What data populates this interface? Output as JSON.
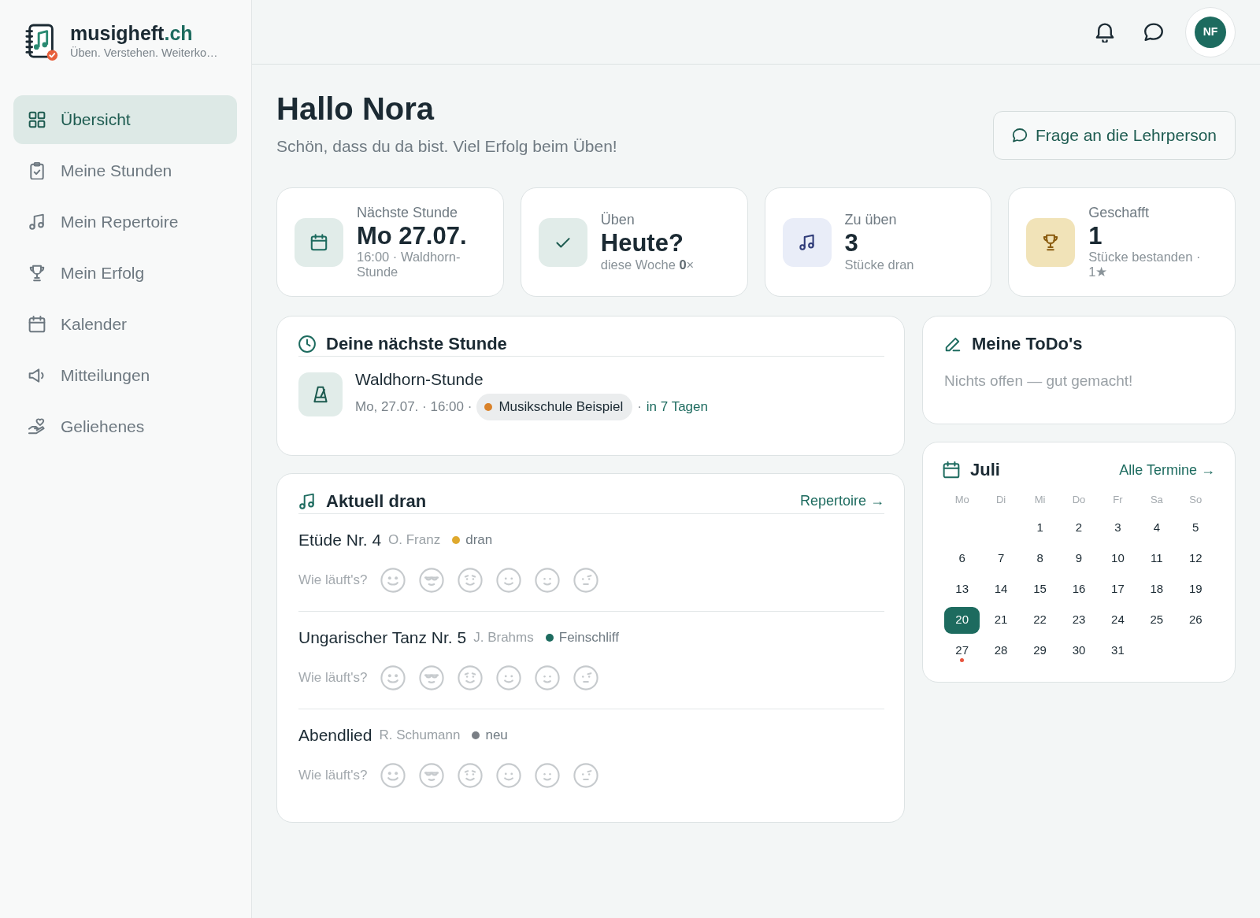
{
  "brand": {
    "name": "musigheft",
    "suffix": ".ch",
    "tagline": "Üben. Verstehen. Weiterko…"
  },
  "sidebar": {
    "items": [
      {
        "label": "Übersicht",
        "selected": true
      },
      {
        "label": "Meine Stunden",
        "selected": false
      },
      {
        "label": "Mein Repertoire",
        "selected": false
      },
      {
        "label": "Mein Erfolg",
        "selected": false
      },
      {
        "label": "Kalender",
        "selected": false
      },
      {
        "label": "Mitteilungen",
        "selected": false
      },
      {
        "label": "Geliehenes",
        "selected": false
      }
    ]
  },
  "header": {
    "avatar": {
      "initials": "NF"
    }
  },
  "greeting": {
    "title": "Hallo Nora",
    "subtitle": "Schön, dass du da bist. Viel Erfolg beim Üben!",
    "button": "Frage an die Lehrperson"
  },
  "stats": [
    {
      "label": "Nächste Stunde",
      "value": "Mo 27.07.",
      "note": "16:00 · Waldhorn-Stunde"
    },
    {
      "label": "Üben",
      "value": "Heute?",
      "note": "diese Woche **0**×"
    },
    {
      "label": "Zu üben",
      "value": "3",
      "note": "Stücke dran"
    },
    {
      "label": "Geschafft",
      "value": "1",
      "note": "Stücke bestanden · 1★"
    }
  ],
  "next_lesson": {
    "title": "Deine nächste Stunde",
    "name": "Waldhorn-Stunde",
    "time": "Mo, 27.07. · 16:00 ·",
    "place": {
      "label": "Musikschule Beispiel",
      "color": "#d9822b"
    },
    "separator": "·",
    "relative": "in 7 Tagen"
  },
  "todos": {
    "title": "Meine ToDo's",
    "empty_message": "Nichts offen — gut gemacht!"
  },
  "current": {
    "title": "Aktuell dran",
    "link": "Repertoire →",
    "items": [
      {
        "title": "Etüde Nr. 4",
        "composer": "O. Franz",
        "status": "dran",
        "color": "#dfa92e",
        "prompt": "Wie läuft's?",
        "moods": [
          {
            "selected": false
          },
          {
            "selected": false
          },
          {
            "selected": false
          },
          {
            "selected": false
          },
          {
            "selected": false
          },
          {
            "selected": false
          }
        ]
      },
      {
        "title": "Ungarischer Tanz Nr. 5",
        "composer": "J. Brahms",
        "status": "Feinschliff",
        "color": "#1d6b5f",
        "prompt": "Wie läuft's?",
        "moods": [
          {
            "selected": false
          },
          {
            "selected": false
          },
          {
            "selected": false
          },
          {
            "selected": false
          },
          {
            "selected": false
          },
          {
            "selected": false
          }
        ]
      },
      {
        "title": "Abendlied",
        "composer": "R. Schumann",
        "status": "neu",
        "color": "#7a7f85",
        "prompt": "Wie läuft's?",
        "moods": [
          {
            "selected": false
          },
          {
            "selected": false
          },
          {
            "selected": false
          },
          {
            "selected": false
          },
          {
            "selected": false
          },
          {
            "selected": false
          }
        ]
      }
    ]
  },
  "calendar": {
    "month": "Juli",
    "link": "Alle Termine →",
    "weekdays": [
      "Mo",
      "Di",
      "Mi",
      "Do",
      "Fr",
      "Sa",
      "So"
    ],
    "weeks": [
      [
        {
          "day": "1",
          "selected": false,
          "event": false
        },
        {
          "day": "2",
          "selected": false,
          "event": false
        },
        {
          "day": "3",
          "selected": false,
          "event": false
        },
        {
          "day": "4",
          "selected": false,
          "event": false
        },
        {
          "day": "5",
          "selected": false,
          "event": false
        }
      ],
      [
        {
          "day": "6",
          "selected": false,
          "event": false
        },
        {
          "day": "7",
          "selected": false,
          "event": false
        },
        {
          "day": "8",
          "selected": false,
          "event": false
        },
        {
          "day": "9",
          "selected": false,
          "event": false
        },
        {
          "day": "10",
          "selected": false,
          "event": false
        },
        {
          "day": "11",
          "selected": false,
          "event": false
        },
        {
          "day": "12",
          "selected": false,
          "event": false
        }
      ],
      [
        {
          "day": "13",
          "selected": false,
          "event": false
        },
        {
          "day": "14",
          "selected": false,
          "event": false
        },
        {
          "day": "15",
          "selected": false,
          "event": false
        },
        {
          "day": "16",
          "selected": false,
          "event": false
        },
        {
          "day": "17",
          "selected": false,
          "event": false
        },
        {
          "day": "18",
          "selected": false,
          "event": false
        },
        {
          "day": "19",
          "selected": false,
          "event": false
        }
      ],
      [
        {
          "day": "20",
          "selected": true,
          "event": false
        },
        {
          "day": "21",
          "selected": false,
          "event": false
        },
        {
          "day": "22",
          "selected": false,
          "event": false
        },
        {
          "day": "23",
          "selected": false,
          "event": false
        },
        {
          "day": "24",
          "selected": false,
          "event": false
        },
        {
          "day": "25",
          "selected": false,
          "event": false
        },
        {
          "day": "26",
          "selected": false,
          "event": false
        }
      ],
      [
        {
          "day": "27",
          "selected": false,
          "event": true
        },
        {
          "day": "28",
          "selected": false,
          "event": false
        },
        {
          "day": "29",
          "selected": false,
          "event": false
        },
        {
          "day": "30",
          "selected": false,
          "event": false
        },
        {
          "day": "31",
          "selected": false,
          "event": false
        }
      ]
    ]
  }
}
